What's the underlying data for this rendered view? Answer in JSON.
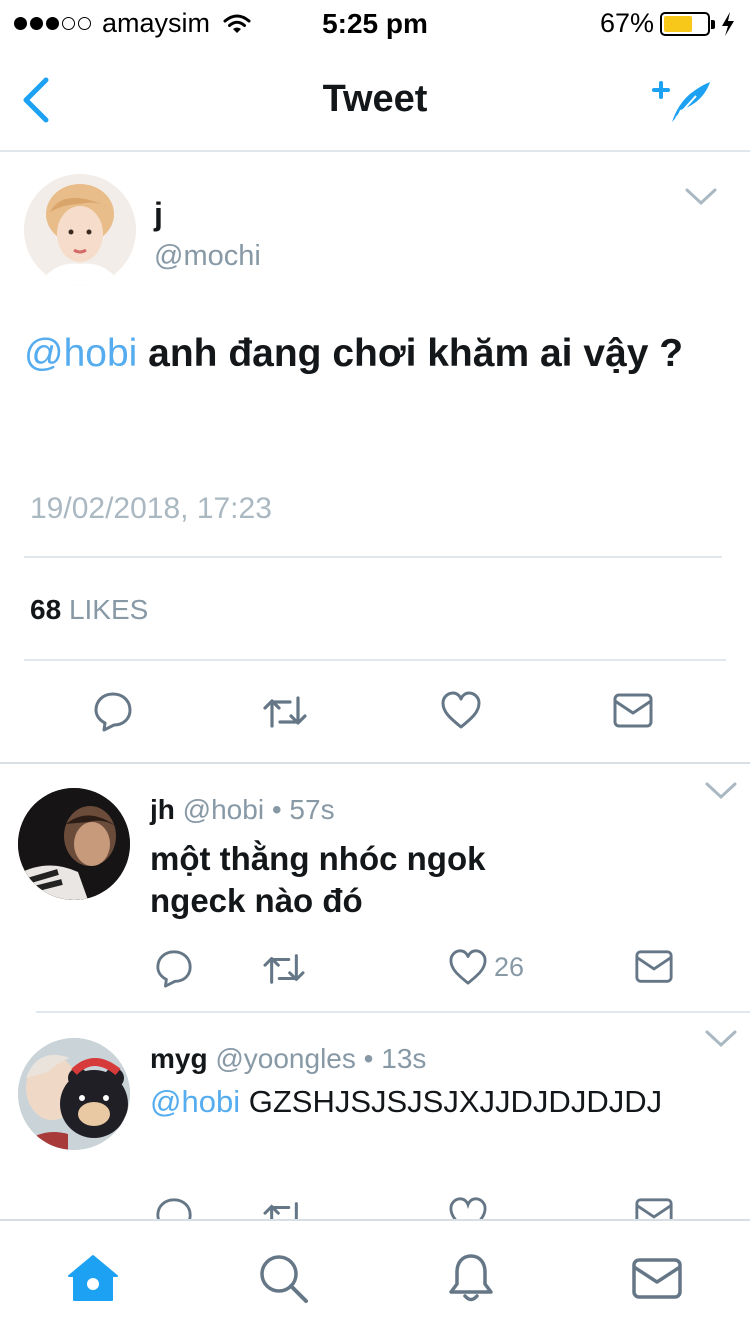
{
  "status_bar": {
    "carrier": "amaysim",
    "time": "5:25 pm",
    "battery": "67%",
    "battery_level": 0.67
  },
  "nav": {
    "title": "Tweet"
  },
  "tweet": {
    "name": "j",
    "handle": "@mochi",
    "mention": "@hobi",
    "text": "anh đang chơi khăm ai vậy ?",
    "timestamp": "19/02/2018, 17:23",
    "likes_count": "68",
    "likes_label": "LIKES"
  },
  "replies": [
    {
      "name": "jh",
      "handle": "@hobi",
      "separator": "•",
      "time": "57s",
      "text_line1": "một thằng nhóc ngok",
      "text_line2": "ngeck nào đó",
      "like_count": "26"
    },
    {
      "name": "myg",
      "handle": "@yoongles",
      "separator": "•",
      "time": "13s",
      "mention": "@hobi",
      "text": "GZSHJSJSJSJXJJDJDJDJDJ"
    }
  ],
  "colors": {
    "accent": "#1da1f2",
    "mention": "#55acee",
    "muted": "#8899a6",
    "divider": "#e1e8ed"
  }
}
